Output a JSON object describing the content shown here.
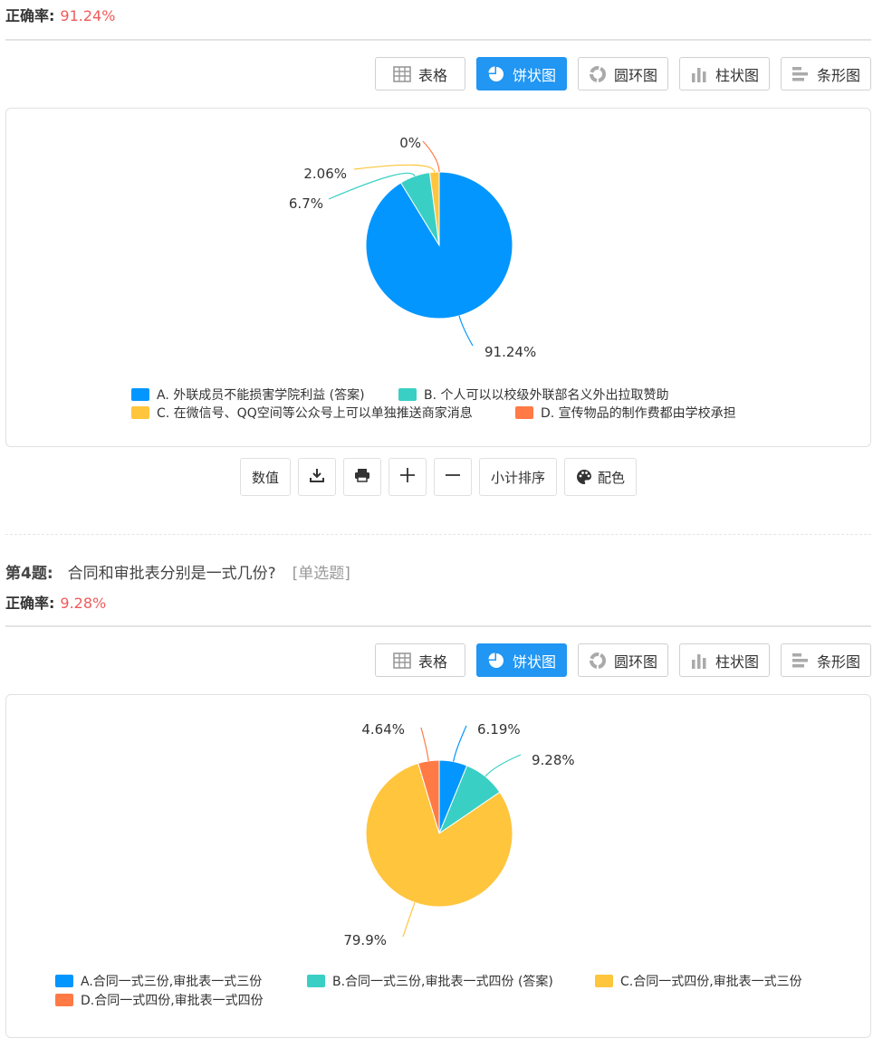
{
  "q3": {
    "accuracy_label": "正确率:",
    "accuracy_value": "91.24%",
    "chart_data": {
      "type": "pie",
      "categories": [
        "A. 外联成员不能损害学院利益 (答案)",
        "B. 个人可以以校级外联部名义外出拉取赞助",
        "C. 在微信号、QQ空间等公众号上可以单独推送商家消息",
        "D. 宣传物品的制作费都由学校承担"
      ],
      "values": [
        91.24,
        6.7,
        2.06,
        0
      ],
      "labels": [
        "91.24%",
        "6.7%",
        "2.06%",
        "0%"
      ],
      "colors": [
        "#0396ff",
        "#3acfc4",
        "#ffc53d",
        "#ff7a45"
      ]
    }
  },
  "q4": {
    "number": "第4题:",
    "question": "合同和审批表分别是一式几份?",
    "type": "[单选题]",
    "accuracy_label": "正确率:",
    "accuracy_value": "9.28%",
    "chart_data": {
      "type": "pie",
      "categories": [
        "A.合同一式三份,审批表一式三份",
        "B.合同一式三份,审批表一式四份 (答案)",
        "C.合同一式四份,审批表一式三份",
        "D.合同一式四份,审批表一式四份"
      ],
      "values": [
        6.19,
        9.28,
        79.9,
        4.64
      ],
      "labels": [
        "6.19%",
        "9.28%",
        "79.9%",
        "4.64%"
      ],
      "colors": [
        "#0396ff",
        "#3acfc4",
        "#ffc53d",
        "#ff7a45"
      ]
    }
  },
  "tabs": {
    "table": "表格",
    "pie": "饼状图",
    "donut": "圆环图",
    "column": "柱状图",
    "bar": "条形图"
  },
  "icons": {
    "table": "table-icon",
    "pie": "pie-chart-icon",
    "donut": "donut-chart-icon",
    "column": "column-chart-icon",
    "bar": "bar-chart-icon",
    "download": "download-icon",
    "print": "print-icon",
    "zoom_in": "plus-icon",
    "zoom_out": "minus-icon",
    "palette": "palette-icon"
  },
  "toolbar": {
    "values": "数值",
    "sort": "小计排序",
    "color": "配色"
  },
  "accent": "#2196f3"
}
